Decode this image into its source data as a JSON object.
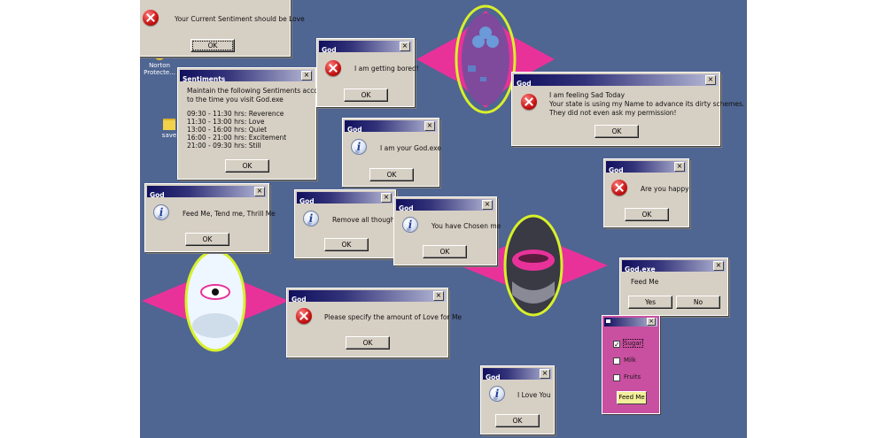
{
  "desktop_icons": [
    {
      "label": "Norton Protecte..."
    },
    {
      "label": "save"
    }
  ],
  "dialogs": {
    "sentiment_top": {
      "message": "Your Current Sentiment should be Love",
      "ok": "OK"
    },
    "sentiments": {
      "title": "Sentiments",
      "intro_1": "Maintain the following Sentiments according",
      "intro_2": "to the time you visit God.exe",
      "schedule": [
        "09:30 - 11:30 hrs: Reverence",
        "11:30 - 13:00 hrs: Love",
        "13:00 - 16:00 hrs: Quiet",
        "16:00 - 21:00 hrs: Excitement",
        "21:00 - 09:30 hrs: Still"
      ],
      "ok": "OK"
    },
    "bored": {
      "title": "God",
      "message": "I am getting bored!",
      "ok": "OK"
    },
    "your_god": {
      "title": "God",
      "message": "I am your God.exe",
      "ok": "OK"
    },
    "sad": {
      "title": "God",
      "line_1": "I am feeling Sad Today",
      "line_2": "Your state is using my Name to advance its dirty schemes.",
      "line_3": "They did not even ask my permission!",
      "ok": "OK"
    },
    "feed_tend": {
      "title": "God",
      "message": "Feed Me, Tend me, Thrill Me",
      "ok": "OK"
    },
    "remove": {
      "title": "God",
      "message": "Remove all thoughts",
      "ok": "OK"
    },
    "chosen": {
      "title": "God",
      "message": "You have Chosen me",
      "ok": "OK"
    },
    "happy": {
      "title": "God",
      "message": "Are you happy",
      "ok": "OK"
    },
    "feed_exe": {
      "title": "God.exe",
      "message": "Feed Me",
      "yes": "Yes",
      "no": "No"
    },
    "love_amount": {
      "title": "God",
      "message": "Please specify the amount of Love for Me",
      "ok": "OK"
    },
    "love_you": {
      "title": "God",
      "message": "I Love You",
      "ok": "OK"
    }
  },
  "feed_panel": {
    "options": [
      {
        "label": "Sugar",
        "checked": true
      },
      {
        "label": "Milk",
        "checked": false
      },
      {
        "label": "Fruits",
        "checked": false
      }
    ],
    "button": "Feed Me"
  },
  "colors": {
    "desktop": "#4f6592",
    "dialog_face": "#d6cfc4",
    "titlebar_dark": "#0f0f5e",
    "accent_magenta": "#e8329a",
    "accent_lime": "#d8f02a",
    "panel_magenta": "#c94fa0"
  },
  "icons": [
    "error-icon",
    "info-icon",
    "close-icon",
    "folder-icon",
    "shield-icon",
    "eye-icon"
  ]
}
